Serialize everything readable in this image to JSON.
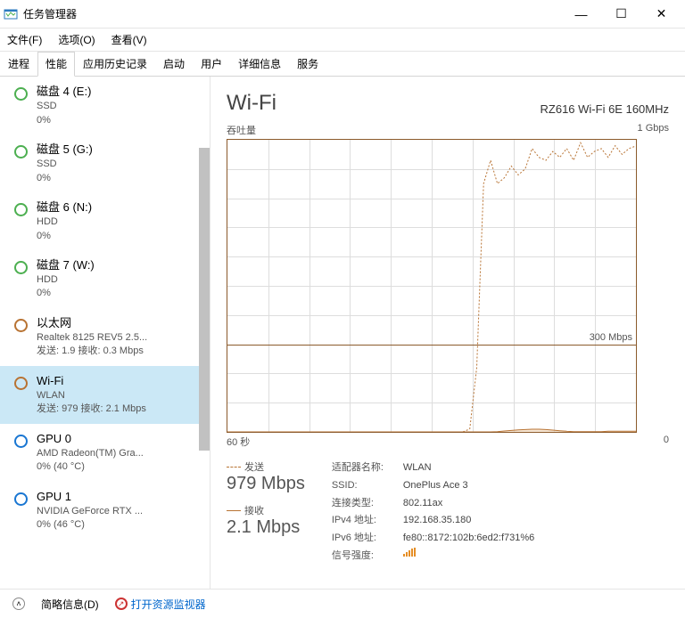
{
  "titlebar": {
    "title": "任务管理器"
  },
  "menubar": {
    "items": [
      "文件(F)",
      "选项(O)",
      "查看(V)"
    ]
  },
  "tabs": {
    "items": [
      "进程",
      "性能",
      "应用历史记录",
      "启动",
      "用户",
      "详细信息",
      "服务"
    ],
    "active": 1
  },
  "sidebar": {
    "items": [
      {
        "name": "磁盘 4 (E:)",
        "sub1": "SSD",
        "sub2": "0%",
        "color": "#4caf50"
      },
      {
        "name": "磁盘 5 (G:)",
        "sub1": "SSD",
        "sub2": "0%",
        "color": "#4caf50"
      },
      {
        "name": "磁盘 6 (N:)",
        "sub1": "HDD",
        "sub2": "0%",
        "color": "#4caf50"
      },
      {
        "name": "磁盘 7 (W:)",
        "sub1": "HDD",
        "sub2": "0%",
        "color": "#4caf50"
      },
      {
        "name": "以太网",
        "sub1": "Realtek 8125 REV5 2.5...",
        "sub2": "发送: 1.9  接收: 0.3 Mbps",
        "color": "#b87333"
      },
      {
        "name": "Wi-Fi",
        "sub1": "WLAN",
        "sub2": "发送: 979  接收: 2.1 Mbps",
        "color": "#b87333",
        "selected": true
      },
      {
        "name": "GPU 0",
        "sub1": "AMD Radeon(TM) Gra...",
        "sub2": "0% (40 °C)",
        "color": "#1976d2"
      },
      {
        "name": "GPU 1",
        "sub1": "NVIDIA GeForce RTX ...",
        "sub2": "0% (46 °C)",
        "color": "#1976d2"
      }
    ]
  },
  "main": {
    "heading": "Wi-Fi",
    "adapter": "RZ616 Wi-Fi 6E 160MHz",
    "chart": {
      "top_left": "吞吐量",
      "top_right": "1 Gbps",
      "baseline_label": "300 Mbps",
      "bottom_left": "60 秒",
      "bottom_right": "0"
    },
    "stats": {
      "send_label": "发送",
      "send_value": "979 Mbps",
      "recv_label": "接收",
      "recv_value": "2.1 Mbps"
    },
    "info": {
      "adapter_name_k": "适配器名称:",
      "adapter_name_v": "WLAN",
      "ssid_k": "SSID:",
      "ssid_v": "OnePlus Ace 3",
      "conn_type_k": "连接类型:",
      "conn_type_v": "802.11ax",
      "ipv4_k": "IPv4 地址:",
      "ipv4_v": "192.168.35.180",
      "ipv6_k": "IPv6 地址:",
      "ipv6_v": "fe80::8172:102b:6ed2:f731%6",
      "signal_k": "信号强度:"
    }
  },
  "footer": {
    "brief": "简略信息(D)",
    "resmon": "打开资源监视器"
  },
  "chart_data": {
    "type": "line",
    "title": "Wi-Fi 吞吐量",
    "x_range_seconds": [
      60,
      0
    ],
    "ylabel": "吞吐量",
    "ylim_mbps": [
      0,
      1000
    ],
    "reference_line_mbps": 300,
    "series": [
      {
        "name": "发送",
        "style": "dashed",
        "values_mbps": [
          0,
          0,
          0,
          0,
          0,
          0,
          0,
          0,
          0,
          0,
          0,
          0,
          0,
          0,
          0,
          0,
          0,
          0,
          0,
          0,
          0,
          0,
          0,
          0,
          0,
          0,
          0,
          0,
          0,
          0,
          0,
          0,
          0,
          0,
          0,
          10,
          220,
          850,
          930,
          850,
          870,
          910,
          880,
          900,
          970,
          940,
          930,
          960,
          940,
          970,
          930,
          990,
          940,
          960,
          970,
          940,
          980,
          950,
          970,
          979
        ]
      },
      {
        "name": "接收",
        "style": "solid",
        "values_mbps": [
          0,
          0,
          0,
          0,
          0,
          0,
          0,
          0,
          0,
          0,
          0,
          0,
          0,
          0,
          0,
          0,
          0,
          0,
          0,
          0,
          0,
          0,
          0,
          0,
          0,
          0,
          0,
          0,
          0,
          0,
          0,
          0,
          0,
          0,
          0,
          0,
          0,
          0,
          0,
          1,
          3,
          5,
          7,
          8,
          9,
          9,
          8,
          6,
          4,
          2,
          1,
          1,
          1,
          1,
          1,
          2,
          2,
          2,
          2,
          2.1
        ]
      }
    ]
  }
}
